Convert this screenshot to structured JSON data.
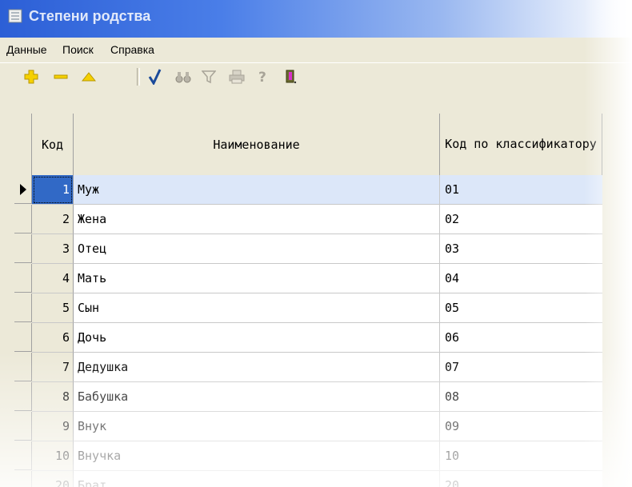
{
  "window": {
    "title": "Степени родства"
  },
  "menu": [
    {
      "label": "Данные"
    },
    {
      "label": "Поиск"
    },
    {
      "label": "Справка"
    }
  ],
  "toolbar": {
    "icons": [
      "add-icon",
      "remove-icon",
      "edit-icon",
      "apply-icon",
      "find-icon",
      "filter-icon",
      "print-icon",
      "help-icon",
      "exit-icon"
    ]
  },
  "grid": {
    "columns": [
      "Код",
      "Наименование",
      "Код по классификатору"
    ],
    "rows": [
      {
        "id": "1",
        "name": "Муж",
        "code": "01",
        "selected": true
      },
      {
        "id": "2",
        "name": "Жена",
        "code": "02"
      },
      {
        "id": "3",
        "name": "Отец",
        "code": "03"
      },
      {
        "id": "4",
        "name": "Мать",
        "code": "04"
      },
      {
        "id": "5",
        "name": "Сын",
        "code": "05"
      },
      {
        "id": "6",
        "name": "Дочь",
        "code": "06"
      },
      {
        "id": "7",
        "name": "Дедушка",
        "code": "07"
      },
      {
        "id": "8",
        "name": "Бабушка",
        "code": "08"
      },
      {
        "id": "9",
        "name": "Внук",
        "code": "09"
      },
      {
        "id": "10",
        "name": "Внучка",
        "code": "10"
      },
      {
        "id": "20",
        "name": "Брат",
        "code": "20"
      }
    ]
  },
  "colors": {
    "titlebar": "#2c5fd6",
    "selection": "#3169c6",
    "selected_row": "#dce7f9",
    "chrome": "#ece9d8"
  }
}
